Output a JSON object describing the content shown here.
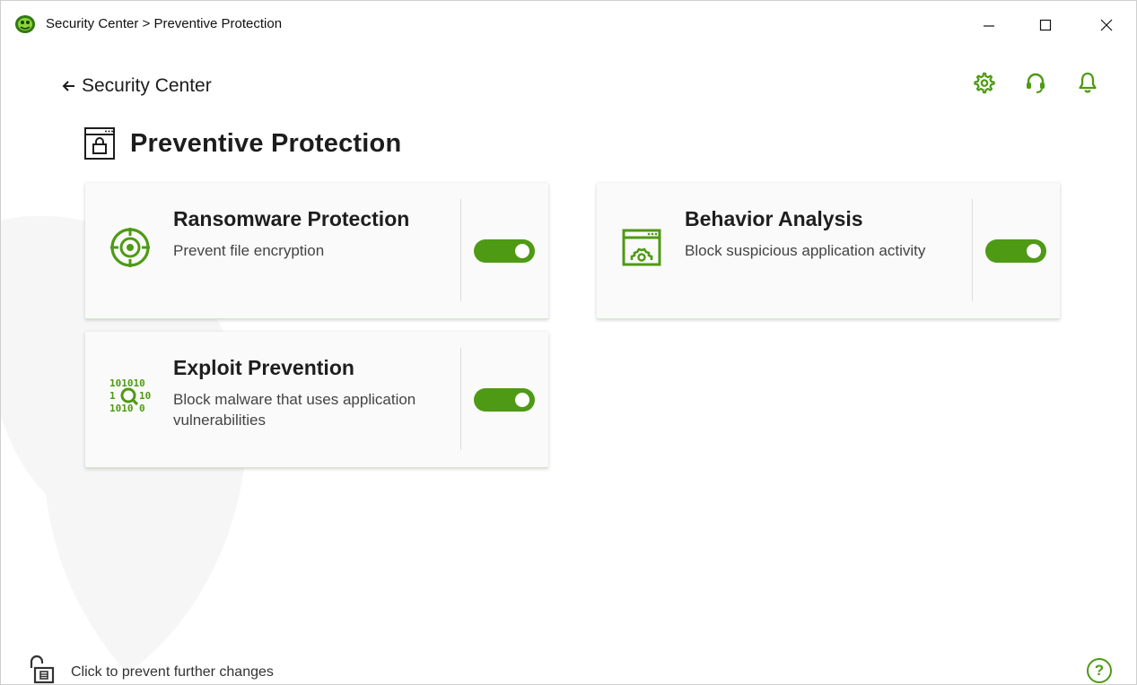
{
  "window": {
    "title": "Security Center > Preventive Protection"
  },
  "nav": {
    "back_label": "Security Center"
  },
  "toolbar": {
    "icons": [
      "gear-icon",
      "headset-icon",
      "bell-icon"
    ]
  },
  "page": {
    "title": "Preventive Protection"
  },
  "cards": [
    {
      "title": "Ransomware Protection",
      "description": "Prevent file encryption",
      "enabled": true,
      "icon": "ransomware-shield-icon"
    },
    {
      "title": "Behavior Analysis",
      "description": "Block suspicious application activity",
      "enabled": true,
      "icon": "behavior-analysis-icon"
    },
    {
      "title": "Exploit Prevention",
      "description": "Block malware that uses application vulnerabilities",
      "enabled": true,
      "icon": "exploit-binary-icon"
    }
  ],
  "footer": {
    "lock_text": "Click to prevent further changes",
    "help_label": "?"
  },
  "colors": {
    "accent": "#4f9a14",
    "toggle_on": "#4f9a14"
  }
}
